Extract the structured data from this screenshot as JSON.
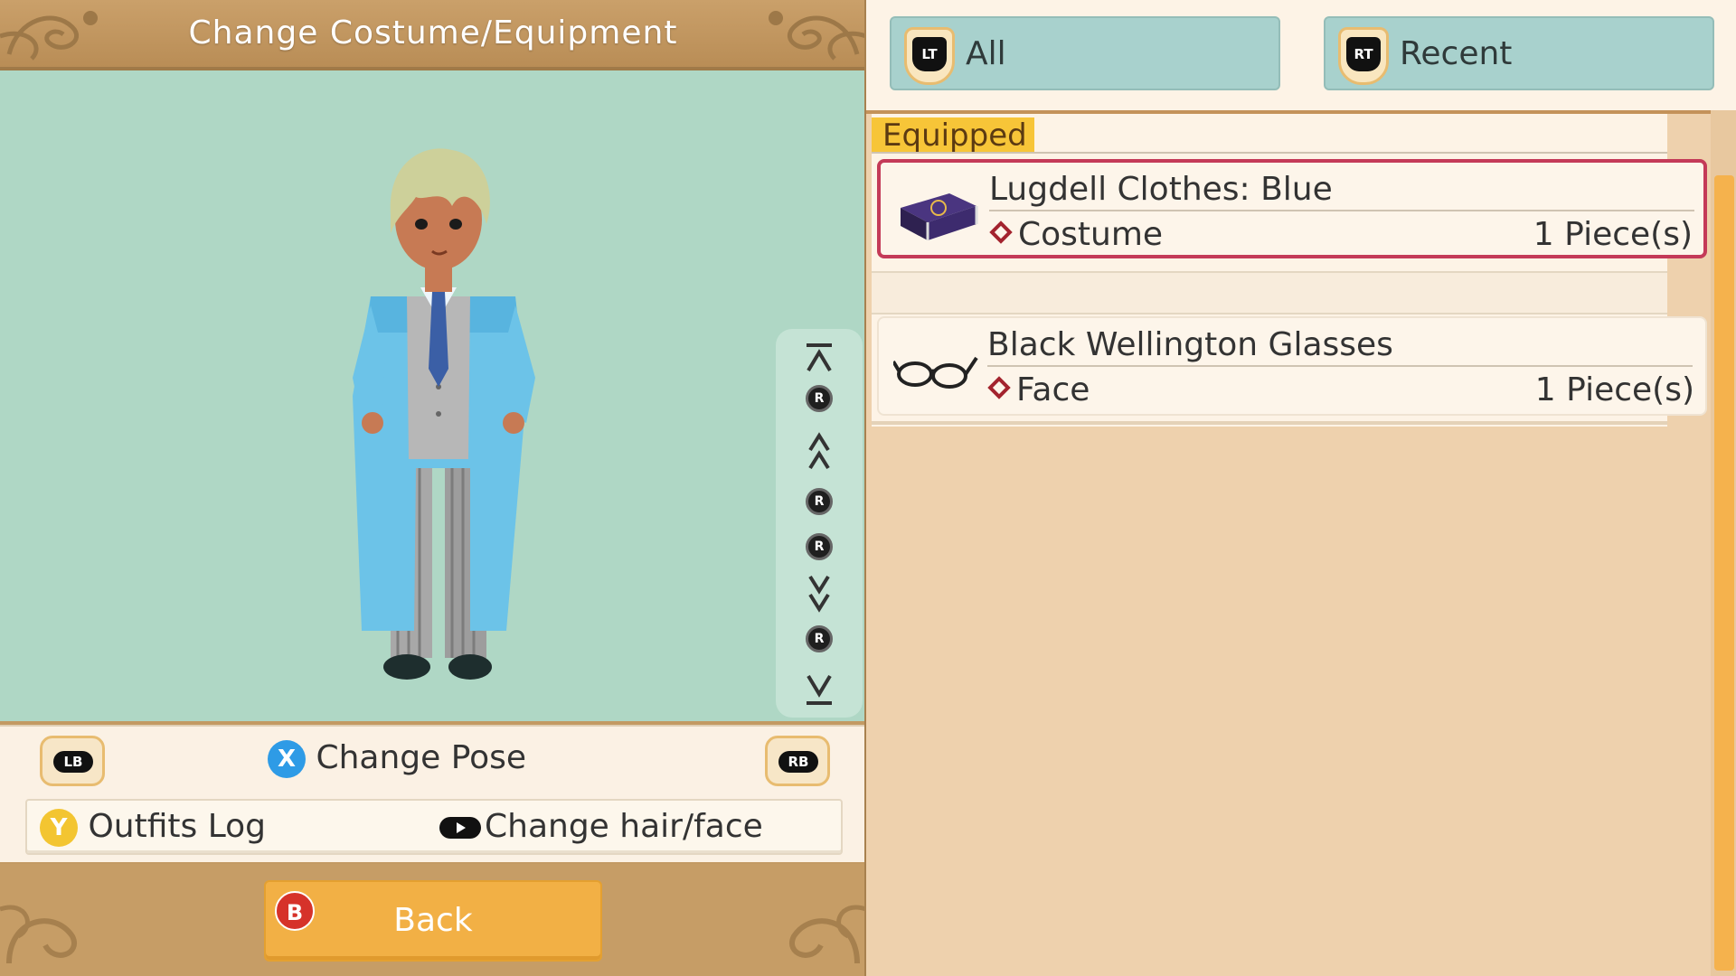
{
  "header": {
    "title": "Change Costume/Equipment"
  },
  "pose_rail": {
    "rstick_label": "R"
  },
  "controls": {
    "lb_label": "LB",
    "rb_label": "RB",
    "x_label": "X",
    "change_pose": "Change Pose",
    "y_label": "Y",
    "outfits_log": "Outfits Log",
    "change_hair_face": "Change hair/face"
  },
  "footer": {
    "b_label": "B",
    "back": "Back"
  },
  "tabs": [
    {
      "trigger": "LT",
      "label": "All"
    },
    {
      "trigger": "RT",
      "label": "Recent"
    }
  ],
  "equipped_label": "Equipped",
  "items": [
    {
      "name": "Lugdell Clothes: Blue",
      "type": "Costume",
      "quantity": "1 Piece(s)",
      "icon": "costume-chest-icon",
      "selected": true
    },
    {
      "name": "Black Wellington Glasses",
      "type": "Face",
      "quantity": "1 Piece(s)",
      "icon": "glasses-icon",
      "selected": false
    }
  ],
  "colors": {
    "accent_orange": "#f2b045",
    "selection_red": "#c43a58",
    "tab_teal": "#a8d1cd",
    "viewport_green": "#afd7c5"
  }
}
